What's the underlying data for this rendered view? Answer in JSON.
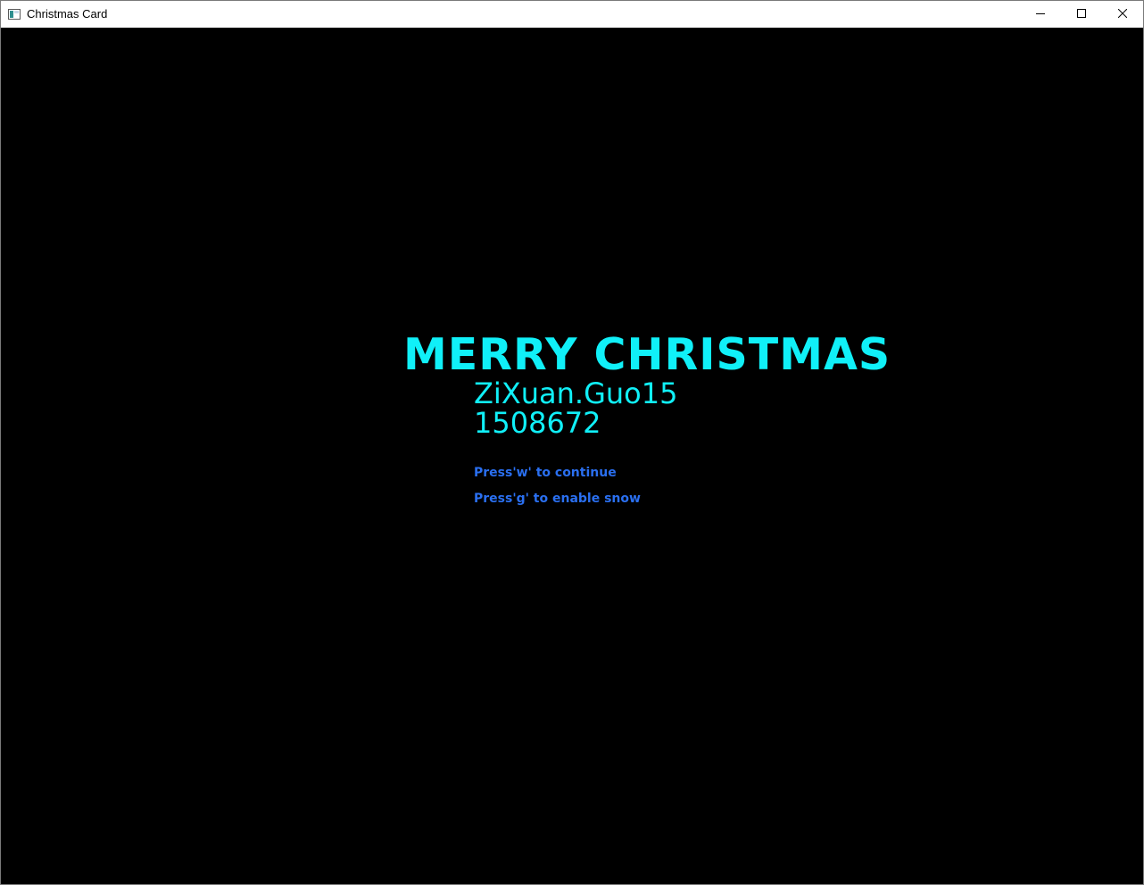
{
  "window": {
    "title": "Christmas Card",
    "controls": {
      "minimize_icon": "minimize-icon",
      "maximize_icon": "maximize-icon",
      "close_icon": "close-icon"
    }
  },
  "card": {
    "greeting": "MERRY CHRISTMAS",
    "author": "ZiXuan.Guo15",
    "student_id": "1508672",
    "hints": [
      "Press'w' to continue",
      "Press'g' to enable snow"
    ]
  },
  "colors": {
    "background": "#000000",
    "primary_text": "#10f0f8",
    "hint_text": "#2a6ff0"
  }
}
